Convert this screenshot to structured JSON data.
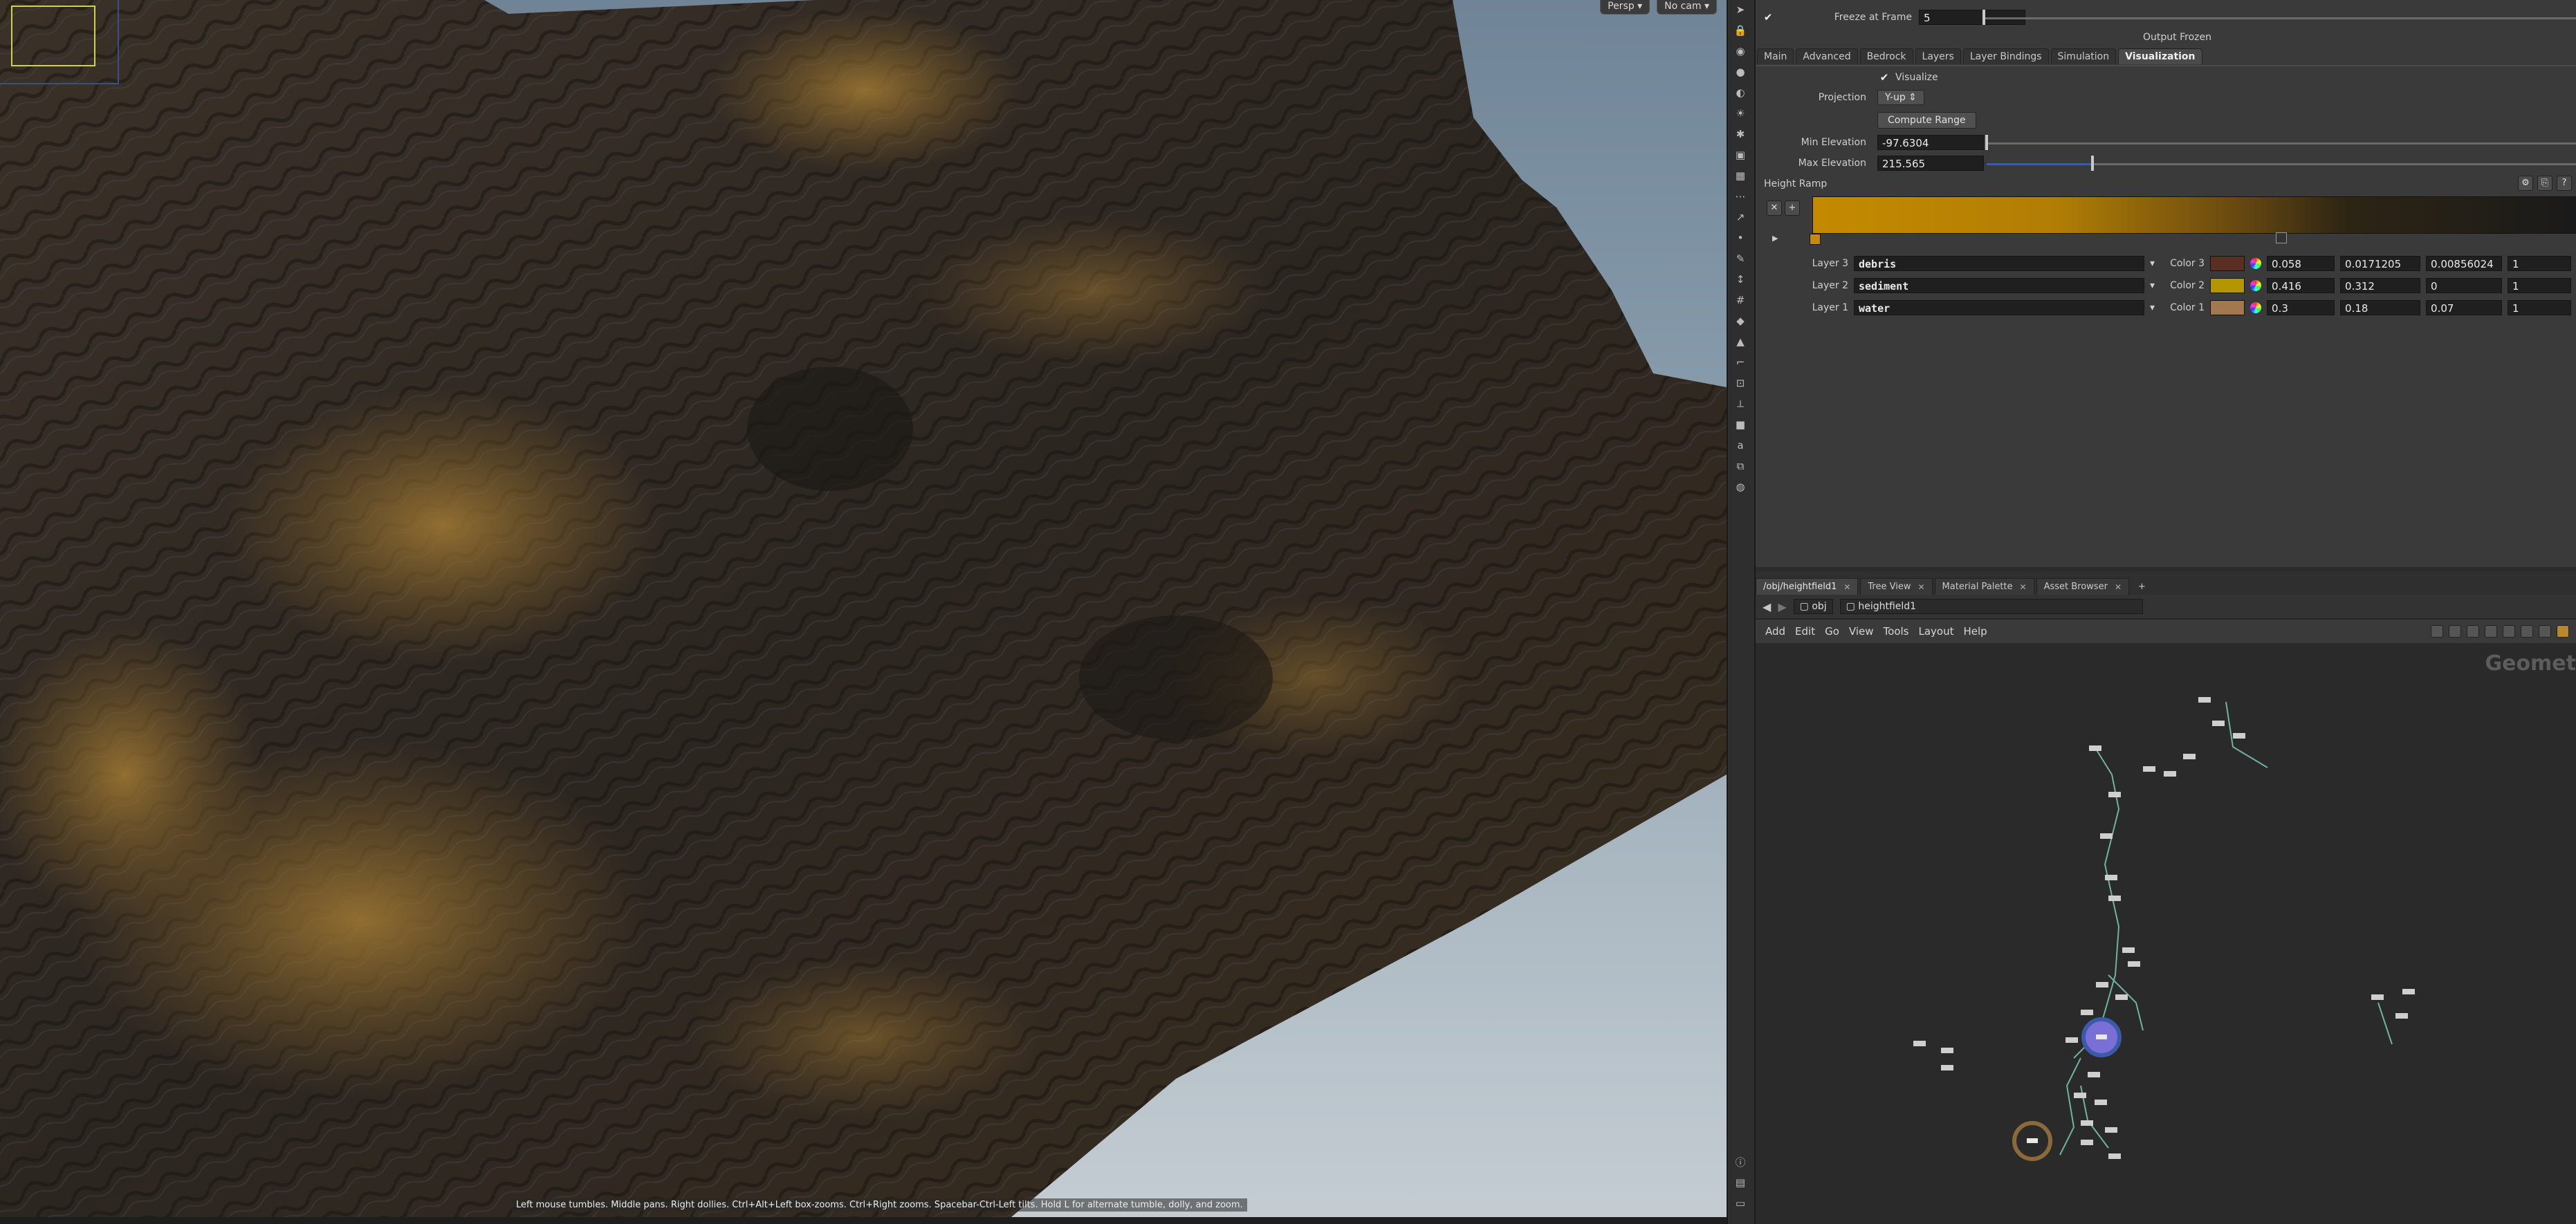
{
  "viewport": {
    "perspective_label": "Persp",
    "camera_label": "No cam",
    "status_message": "Left mouse tumbles. Middle pans. Right dollies. Ctrl+Alt+Left box-zooms. Ctrl+Right zooms. Spacebar-Ctrl-Left tilts. Hold L for alternate tumble, dolly, and zoom."
  },
  "params": {
    "freeze_label": "Freeze at Frame",
    "freeze_value": "5",
    "output_status": "Output Frozen",
    "tabs": [
      {
        "label": "Main",
        "active": false
      },
      {
        "label": "Advanced",
        "active": false
      },
      {
        "label": "Bedrock",
        "active": false
      },
      {
        "label": "Layers",
        "active": false
      },
      {
        "label": "Layer Bindings",
        "active": false
      },
      {
        "label": "Simulation",
        "active": false
      },
      {
        "label": "Visualization",
        "active": true
      }
    ],
    "visualize_label": "Visualize",
    "projection_label": "Projection",
    "projection_value": "Y-up",
    "compute_range_label": "Compute Range",
    "min_elevation_label": "Min Elevation",
    "min_elevation_value": "-97.6304",
    "max_elevation_label": "Max Elevation",
    "max_elevation_value": "215.565",
    "max_elevation_fraction": 0.18,
    "height_ramp_label": "Height Ramp",
    "layers": [
      {
        "layer_label": "Layer 3",
        "name": "debris",
        "color_label": "Color 3",
        "swatch": "#5a2e22",
        "r": "0.058",
        "g": "0.0171205",
        "b": "0.00856024",
        "a": "1"
      },
      {
        "layer_label": "Layer 2",
        "name": "sediment",
        "color_label": "Color 2",
        "swatch": "#b39600",
        "r": "0.416",
        "g": "0.312",
        "b": "0",
        "a": "1"
      },
      {
        "layer_label": "Layer 1",
        "name": "water",
        "color_label": "Color 1",
        "swatch": "#a3784f",
        "r": "0.3",
        "g": "0.18",
        "b": "0.07",
        "a": "1"
      }
    ]
  },
  "pane_tabs": [
    {
      "label": "/obj/heightfield1",
      "active": true
    },
    {
      "label": "Tree View",
      "active": false
    },
    {
      "label": "Material Palette",
      "active": false
    },
    {
      "label": "Asset Browser",
      "active": false
    }
  ],
  "path": {
    "root": "obj",
    "node": "heightfield1"
  },
  "menu": [
    "Add",
    "Edit",
    "Go",
    "View",
    "Tools",
    "Layout",
    "Help"
  ],
  "network": {
    "context_label": "Geomet"
  },
  "colors": {
    "accent_blue": "#3c5aa8",
    "selected_node": "#7a6fd6",
    "display_ring": "#8a6a3a",
    "wire": "#6fb3a0"
  }
}
